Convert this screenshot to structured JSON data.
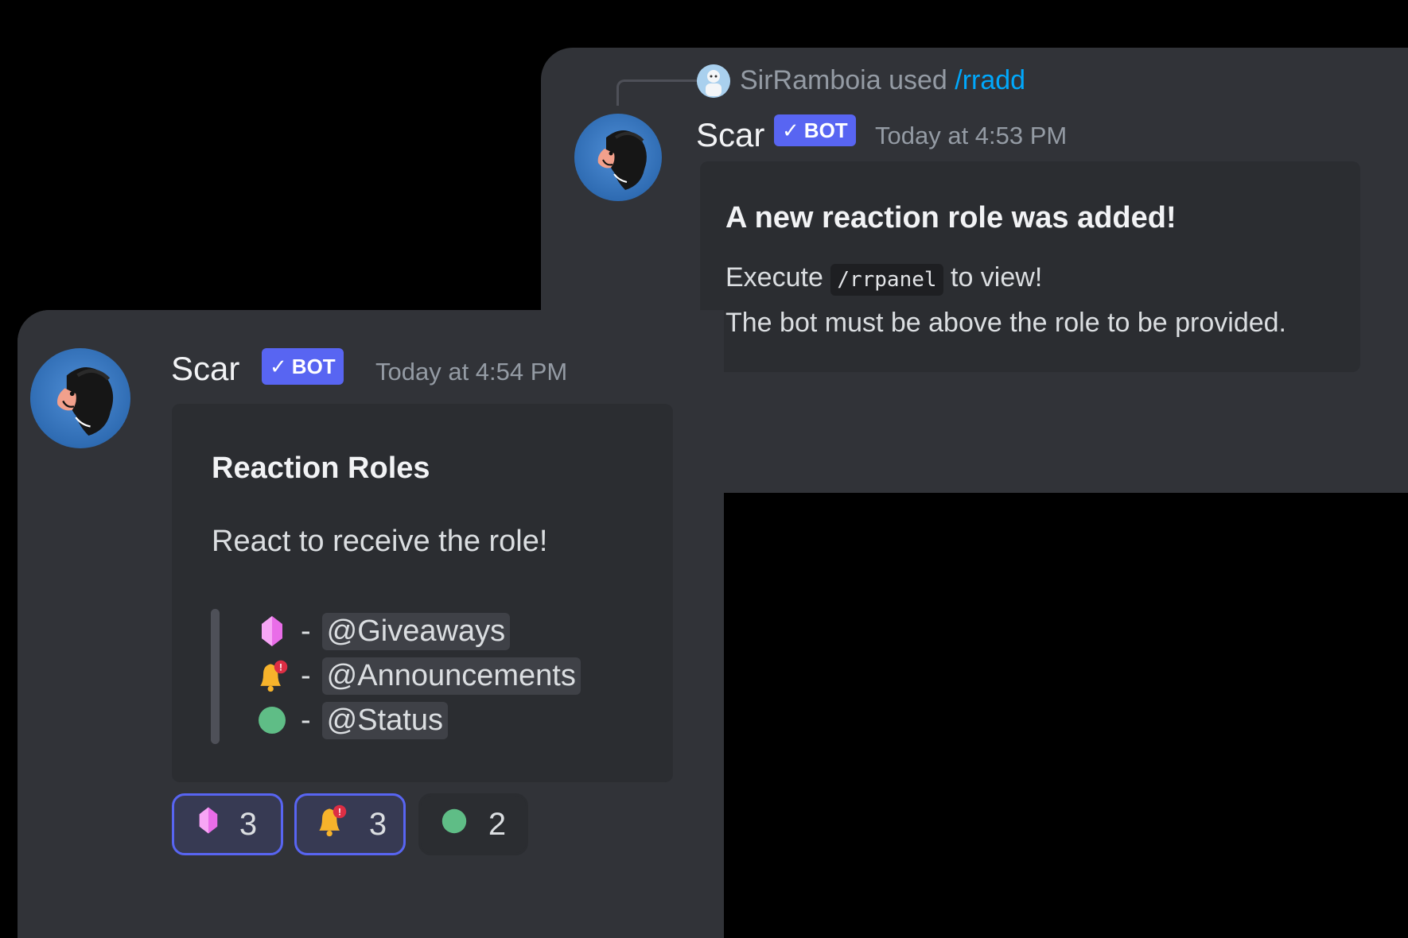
{
  "reply": {
    "user": "SirRamboia",
    "used_word": "used",
    "command": "/rradd"
  },
  "message1": {
    "author": "Scar",
    "badge": "BOT",
    "badge_check": "✓",
    "timestamp": "Today at 4:53 PM",
    "embed": {
      "title": "A new reaction role was added!",
      "line1_prefix": "Execute",
      "line1_code": "/rrpanel",
      "line1_suffix": "to view!",
      "line2": "The bot must be above the role to be provided."
    }
  },
  "message2": {
    "author": "Scar",
    "badge": "BOT",
    "badge_check": "✓",
    "timestamp": "Today at 4:54 PM",
    "embed": {
      "title": "Reaction Roles",
      "description": "React to receive the role!",
      "roles": [
        {
          "emoji": "gem-icon",
          "separator": "-",
          "mention": "@Giveaways"
        },
        {
          "emoji": "bell-notification-icon",
          "separator": "-",
          "mention": "@Announcements"
        },
        {
          "emoji": "green-circle-icon",
          "separator": "-",
          "mention": "@Status"
        }
      ]
    },
    "reactions": [
      {
        "emoji": "gem-icon",
        "count": "3",
        "active": true
      },
      {
        "emoji": "bell-notification-icon",
        "count": "3",
        "active": true
      },
      {
        "emoji": "green-circle-icon",
        "count": "2",
        "active": false
      }
    ]
  },
  "colors": {
    "background": "#313338",
    "embed": "#2b2d31",
    "blurple": "#5865f2",
    "link": "#00a8fc",
    "muted": "#949ba4"
  }
}
